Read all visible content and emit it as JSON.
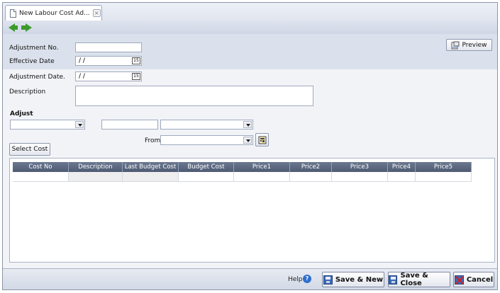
{
  "tab": {
    "label": "New Labour Cost Ad...",
    "close_glyph": "×"
  },
  "nav": {
    "back_icon": "arrow-left-icon",
    "forward_icon": "arrow-right-icon"
  },
  "header": {
    "preview_label": "Preview",
    "adjustment_no_label": "Adjustment No.",
    "adjustment_no_value": "",
    "effective_date_label": "Effective Date",
    "effective_date_value": "/ /",
    "calendar_glyph": "15"
  },
  "form": {
    "adjustment_date_label": "Adjustment Date.",
    "adjustment_date_value": "/ /",
    "description_label": "Description",
    "description_value": "",
    "adjust_heading": "Adjust",
    "from_label": "From",
    "select_cost_label": "Select Cost"
  },
  "grid": {
    "columns": [
      {
        "label": "Cost No"
      },
      {
        "label": "Description"
      },
      {
        "label": "Last Budget Cost"
      },
      {
        "label": "Budget Cost"
      },
      {
        "label": "Price1"
      },
      {
        "label": "Price2"
      },
      {
        "label": "Price3"
      },
      {
        "label": "Price4"
      },
      {
        "label": "Price5"
      }
    ]
  },
  "footer": {
    "help_label": "Help",
    "help_glyph": "?",
    "save_new_label": "Save & New",
    "save_close_label": "Save & Close",
    "cancel_label": "Cancel"
  },
  "colors": {
    "header_band": "#dbe1ec",
    "grid_header": "#4e5b73",
    "nav_arrow": "#3c9a2c",
    "save_icon": "#3b69b8"
  }
}
